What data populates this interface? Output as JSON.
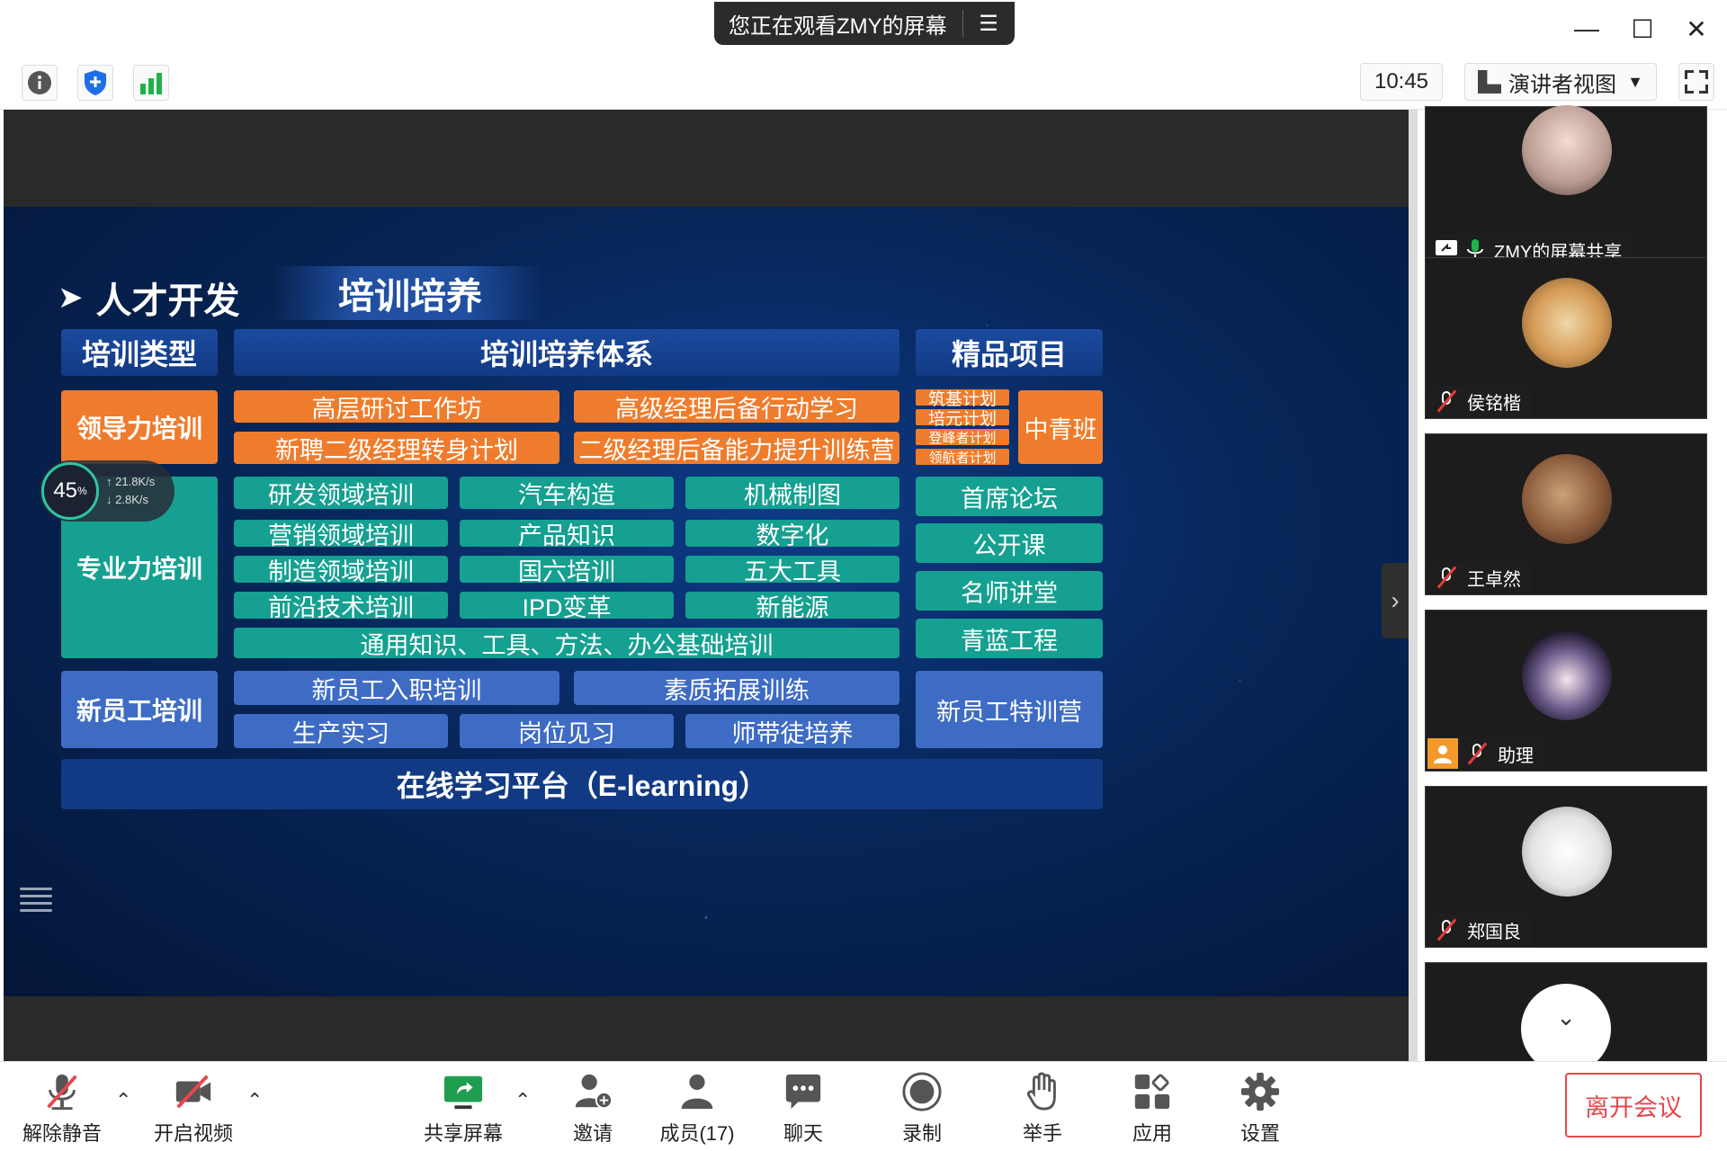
{
  "window": {
    "sharing_notice": "您正在观看ZMY的屏幕",
    "minimize": "—",
    "maximize": "☐",
    "close": "✕"
  },
  "toolbar": {
    "time": "10:45",
    "view_label": "演讲者视图"
  },
  "slide": {
    "heading": "人才开发",
    "subheading": "培训培养",
    "headers": {
      "type": "培训类型",
      "system": "培训培养体系",
      "premium": "精品项目"
    },
    "leadership_type": "领导力培训",
    "leadership_items": [
      "高层研讨工作坊",
      "高级经理后备行动学习",
      "新聘二级经理转身计划",
      "二级经理后备能力提升训练营"
    ],
    "leadership_small": [
      "筑基计划",
      "培元计划",
      "登峰者计划",
      "领航者计划"
    ],
    "leadership_premium": "中青班",
    "pro_type": "专业力培训",
    "pro_items": [
      [
        "研发领域培训",
        "汽车构造",
        "机械制图"
      ],
      [
        "营销领域培训",
        "产品知识",
        "数字化"
      ],
      [
        "制造领域培训",
        "国六培训",
        "五大工具"
      ],
      [
        "前沿技术培训",
        "IPD变革",
        "新能源"
      ]
    ],
    "pro_general": "通用知识、工具、方法、办公基础培训",
    "pro_premium": [
      "首席论坛",
      "公开课",
      "名师讲堂",
      "青蓝工程"
    ],
    "new_type": "新员工培训",
    "new_items_top": [
      "新员工入职培训",
      "素质拓展训练"
    ],
    "new_items_bottom": [
      "生产实习",
      "岗位见习",
      "师带徒培养"
    ],
    "new_premium": "新员工特训营",
    "platform": "在线学习平台（E-learning）"
  },
  "network": {
    "percent": "45",
    "percent_unit": "%",
    "up": "21.8K/s",
    "down": "2.8K/s"
  },
  "participants": [
    {
      "name": "ZMY的屏幕共享"
    },
    {
      "name": "侯铭楷"
    },
    {
      "name": "王卓然"
    },
    {
      "name": "助理"
    },
    {
      "name": "郑国良"
    }
  ],
  "bottom": {
    "unmute": "解除静音",
    "video": "开启视频",
    "share": "共享屏幕",
    "invite": "邀请",
    "members": "成员(17)",
    "chat": "聊天",
    "record": "录制",
    "raise_hand": "举手",
    "apps": "应用",
    "settings": "设置",
    "leave": "离开会议"
  },
  "colors": {
    "orange": "#ef7c2c",
    "teal": "#15a091",
    "blue": "#3e6cc4",
    "navy": "#123a84",
    "leave_red": "#e5484d"
  }
}
